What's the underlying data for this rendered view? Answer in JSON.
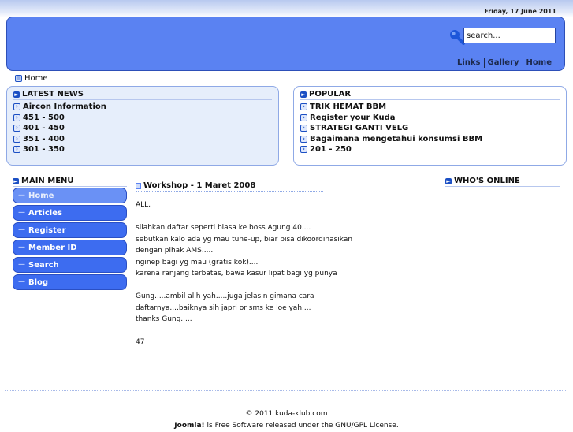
{
  "header": {
    "date": "Friday, 17 June 2011",
    "search_placeholder": "search...",
    "search_value": "search...",
    "nav": [
      "Links",
      "Gallery",
      "Home"
    ]
  },
  "breadcrumb": {
    "label": "Home"
  },
  "latest_news": {
    "title": "LATEST NEWS",
    "items": [
      "Aircon Information",
      "451 - 500",
      "401 - 450",
      "351 - 400",
      "301 - 350"
    ]
  },
  "popular": {
    "title": "POPULAR",
    "items": [
      "TRIK HEMAT BBM",
      "Register your Kuda",
      "STRATEGI GANTI VELG",
      "Bagaimana mengetahui konsumsi BBM",
      "201 - 250"
    ]
  },
  "main_menu": {
    "title": "MAIN MENU",
    "items": [
      "Home",
      "Articles",
      "Register",
      "Member ID",
      "Search",
      "Blog"
    ]
  },
  "whos_online": {
    "title": "WHO'S ONLINE"
  },
  "article": {
    "title": "Workshop - 1 Maret 2008",
    "lines": [
      "ALL,",
      "",
      "silahkan daftar seperti biasa ke boss Agung 40....",
      "sebutkan kalo ada yg mau tune-up, biar bisa dikoordinasikan",
      "dengan pihak AMS.....",
      "nginep bagi yg mau (gratis kok)....",
      "karena ranjang terbatas, bawa kasur lipat bagi yg punya",
      "",
      "Gung.....ambil alih yah.....juga jelasin gimana cara",
      "daftarnya....baiknya sih japri or sms ke loe yah....",
      "thanks Gung.....",
      "",
      "47"
    ]
  },
  "footer": {
    "copyright": "© 2011 kuda-klub.com",
    "brand": "Joomla!",
    "license_text": " is Free Software released under the GNU/GPL License."
  },
  "colors": {
    "header_blue": "#5a82f2",
    "box_bg": "#e6eefb",
    "menu_blue": "#3d6cf0"
  }
}
